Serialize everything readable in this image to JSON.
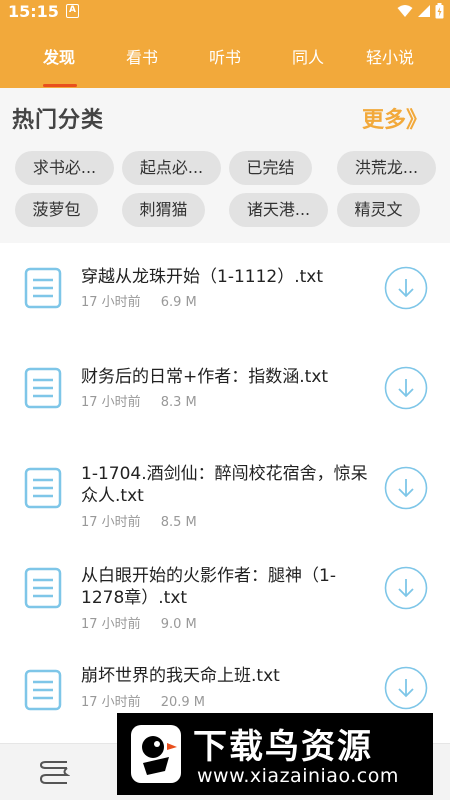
{
  "status_bar": {
    "time": "15:15",
    "notification_glyph": "A",
    "icons": [
      "wifi-icon",
      "signal-icon",
      "battery-icon"
    ]
  },
  "tabs": [
    {
      "label": "发现",
      "active": true
    },
    {
      "label": "看书",
      "active": false
    },
    {
      "label": "听书",
      "active": false
    },
    {
      "label": "同人",
      "active": false
    },
    {
      "label": "轻小说",
      "active": false
    }
  ],
  "categories": {
    "title": "热门分类",
    "more_label": "更多》",
    "chips": [
      "求书必...",
      "起点必...",
      "已完结",
      "洪荒龙...",
      "菠萝包",
      "刺猬猫",
      "诸天港...",
      "精灵文"
    ]
  },
  "files": [
    {
      "title": "穿越从龙珠开始（1-1112）.txt",
      "time": "17 小时前",
      "size": "6.9 M"
    },
    {
      "title": "财务后的日常+作者：指数涵.txt",
      "time": "17 小时前",
      "size": "8.3 M"
    },
    {
      "title": "1-1704.酒剑仙：醉闯校花宿舍，惊呆众人.txt",
      "time": "17 小时前",
      "size": "8.5 M"
    },
    {
      "title": "从白眼开始的火影作者：腿神（1-1278章）.txt",
      "time": "17 小时前",
      "size": "9.0 M"
    },
    {
      "title": "崩坏世界的我天命上班.txt",
      "time": "17 小时前",
      "size": "20.9 M"
    }
  ],
  "watermark": {
    "brand": "下载鸟资源",
    "url": "www.xiazainiao.com"
  },
  "colors": {
    "accent": "#F2A93B",
    "tab_indicator": "#E94F1D",
    "icon_blue": "#7EC6E8"
  }
}
